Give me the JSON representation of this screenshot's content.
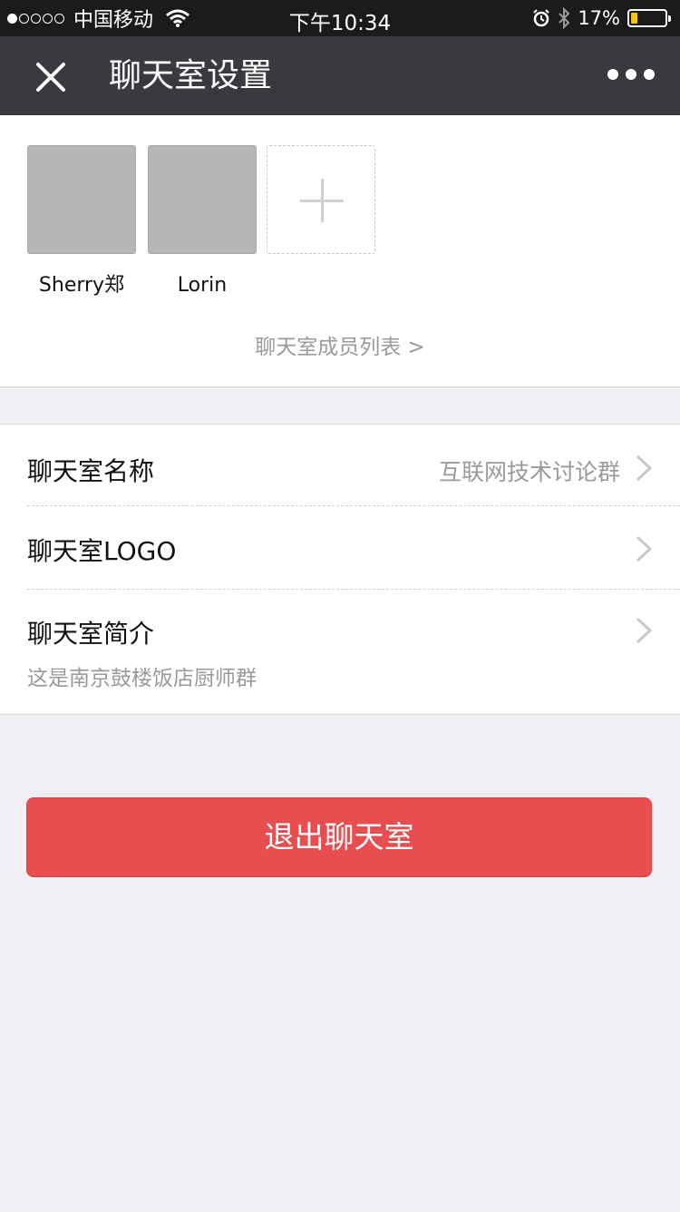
{
  "status_bar": {
    "carrier": "中国移动",
    "time": "下午10:34",
    "battery_percent": "17%",
    "battery_level": 0.17,
    "signal_strength": 1,
    "icons": [
      "wifi-icon",
      "alarm-icon",
      "bluetooth-icon",
      "battery-icon"
    ]
  },
  "nav": {
    "title": "聊天室设置",
    "close_icon": "close-icon",
    "more_icon": "more-icon"
  },
  "members": {
    "items": [
      {
        "name": "Sherry郑"
      },
      {
        "name": "Lorin"
      }
    ],
    "add_icon": "plus-icon",
    "list_link": "聊天室成员列表 >"
  },
  "settings": {
    "name_label": "聊天室名称",
    "name_value": "互联网技术讨论群",
    "logo_label": "聊天室LOGO",
    "intro_label": "聊天室简介",
    "intro_value": "这是南京鼓楼饭店厨师群"
  },
  "exit_button": "退出聊天室",
  "colors": {
    "nav_bg": "#393a3f",
    "danger": "#e84e50",
    "page_bg": "#efeff4"
  }
}
